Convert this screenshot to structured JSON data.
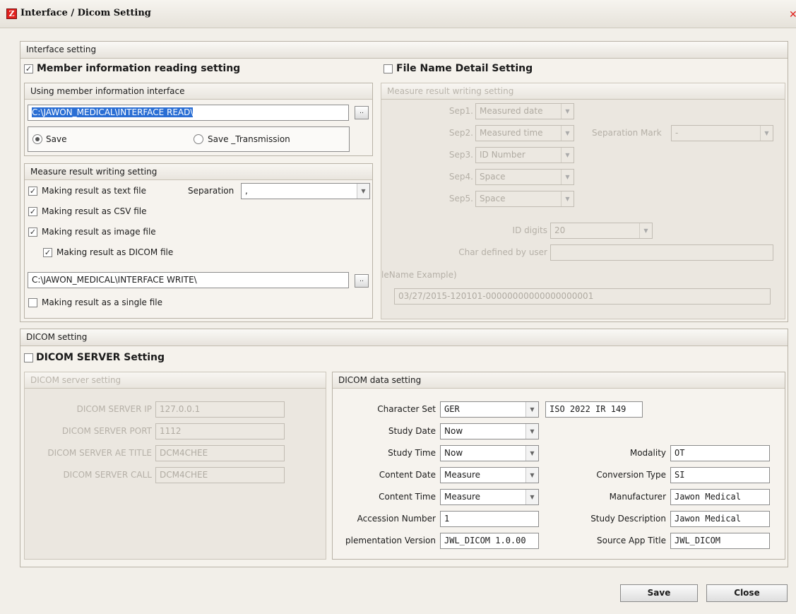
{
  "window": {
    "title": "Interface / Dicom Setting",
    "close_glyph": "✕",
    "logo_letter": "Z"
  },
  "interface": {
    "header": "Interface setting",
    "member_reading": {
      "label": "Member information reading setting",
      "checked": true
    },
    "file_name_detail": {
      "label": "File Name Detail Setting",
      "checked": false
    },
    "using_member": {
      "header": "Using member information interface",
      "path": "C:\\JAWON_MEDICAL\\INTERFACE READ\\",
      "browse": "..",
      "radio_save": "Save",
      "radio_save_transmission": "Save _Transmission"
    },
    "measure_writing": {
      "header": "Measure result writing setting",
      "text_file": "Making result as text file",
      "separation_label": "Separation",
      "separation_value": ",",
      "csv_file": "Making result as CSV file",
      "image_file": "Making result as image file",
      "dicom_file": "Making result as DICOM file",
      "path": "C:\\JAWON_MEDICAL\\INTERFACE WRITE\\",
      "browse": "..",
      "single_file": "Making result as a single file"
    },
    "detail_writing": {
      "header": "Measure result writing setting",
      "seps": [
        {
          "label": "Sep1.",
          "value": "Measured date"
        },
        {
          "label": "Sep2.",
          "value": "Measured time"
        },
        {
          "label": "Sep3.",
          "value": "ID Number"
        },
        {
          "label": "Sep4.",
          "value": "Space"
        },
        {
          "label": "Sep5.",
          "value": "Space"
        }
      ],
      "separation_mark_label": "Separation Mark",
      "separation_mark_value": "-",
      "id_digits_label": "ID digits",
      "id_digits_value": "20",
      "char_user_label": "Char defined by user",
      "char_user_value": "",
      "example_label": "leName Example)",
      "example_value": "03/27/2015-120101-00000000000000000001"
    }
  },
  "dicom": {
    "header": "DICOM setting",
    "server_setting": {
      "label": "DICOM SERVER Setting",
      "checked": false
    },
    "server": {
      "header": "DICOM server setting",
      "ip_label": "DICOM SERVER IP",
      "ip": "127.0.0.1",
      "port_label": "DICOM SERVER PORT",
      "port": "1112",
      "ae_label": "DICOM SERVER AE TITLE",
      "ae": "DCM4CHEE",
      "call_label": "DICOM SERVER CALL",
      "call": "DCM4CHEE"
    },
    "data": {
      "header": "DICOM data setting",
      "charset_label": "Character Set",
      "charset": "GER",
      "charset_code": "ISO 2022 IR 149",
      "study_date_label": "Study Date",
      "study_date": "Now",
      "study_time_label": "Study Time",
      "study_time": "Now",
      "content_date_label": "Content Date",
      "content_date": "Measure",
      "content_time_label": "Content Time",
      "content_time": "Measure",
      "accession_label": "Accession Number",
      "accession": "1",
      "impl_label": "plementation Version",
      "impl": "JWL_DICOM 1.0.00",
      "modality_label": "Modality",
      "modality": "OT",
      "conversion_label": "Conversion Type",
      "conversion": "SI",
      "manufacturer_label": "Manufacturer",
      "manufacturer": "Jawon Medical",
      "study_desc_label": "Study Description",
      "study_desc": "Jawon Medical",
      "source_app_label": "Source App Title",
      "source_app": "JWL_DICOM"
    }
  },
  "footer": {
    "save": "Save",
    "close": "Close"
  }
}
